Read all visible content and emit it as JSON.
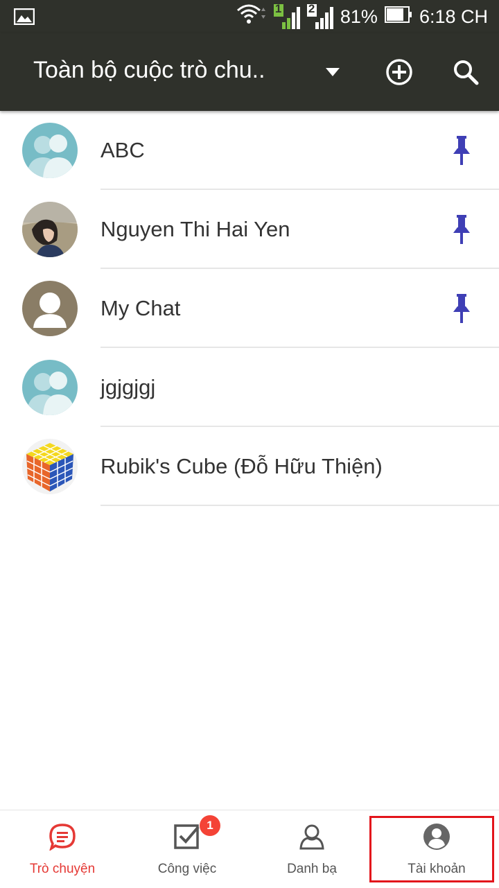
{
  "status_bar": {
    "signal_sim1_label": "1",
    "signal_sim2_label": "2",
    "battery_percent": "81%",
    "time": "6:18 CH"
  },
  "app_bar": {
    "title": "Toàn bộ cuộc trò chu..",
    "icons": [
      "chevron-down-icon",
      "add-circle-icon",
      "search-icon"
    ]
  },
  "conversations": [
    {
      "name": "ABC",
      "pinned": true,
      "avatar": "group-avatar"
    },
    {
      "name": "Nguyen Thi Hai Yen",
      "pinned": true,
      "avatar": "photo-avatar"
    },
    {
      "name": "My Chat",
      "pinned": true,
      "avatar": "person-avatar"
    },
    {
      "name": "jgjgjgj",
      "pinned": false,
      "avatar": "group-avatar"
    },
    {
      "name": "Rubik's Cube (Đỗ Hữu Thiện)",
      "pinned": false,
      "avatar": "rubik-avatar"
    }
  ],
  "bottom_nav": {
    "tabs": [
      {
        "label": "Trò chuyện",
        "icon": "chat-icon",
        "active": true
      },
      {
        "label": "Công việc",
        "icon": "task-icon",
        "active": false
      },
      {
        "label": "Danh bạ",
        "icon": "contacts-icon",
        "active": false
      },
      {
        "label": "Tài khoản",
        "icon": "account-icon",
        "active": false
      }
    ],
    "task_badge": "1"
  },
  "colors": {
    "app_bar": "#2f312b",
    "accent_active": "#e53935",
    "pin": "#3f3fb5",
    "highlight_box": "#e3141b",
    "badge": "#f44336"
  }
}
